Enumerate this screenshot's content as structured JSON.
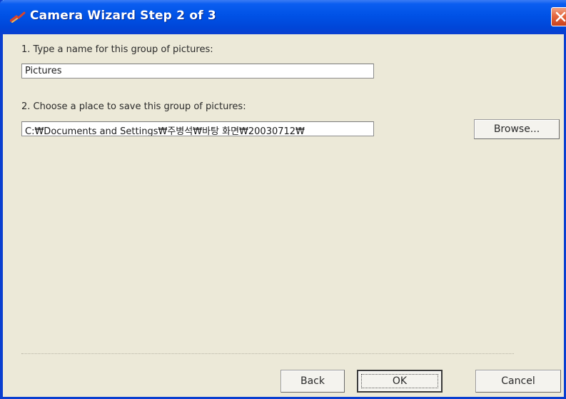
{
  "window": {
    "title": "Camera Wizard Step 2 of 3",
    "title_icon": "camera-wizard-icon",
    "close_icon": "close-icon",
    "colors": {
      "titlebar": "#0052e6",
      "close_button": "#e4683f",
      "body": "#ece9d8"
    }
  },
  "step1": {
    "label": "1. Type a name for this group of pictures:",
    "value": "Pictures"
  },
  "step2": {
    "label": "2. Choose a place to save this group of pictures:",
    "value": "C:₩Documents and Settings₩주병석₩바탕 화면₩20030712₩",
    "browse_label": "Browse..."
  },
  "buttons": {
    "back": "Back",
    "ok": "OK",
    "cancel": "Cancel"
  }
}
